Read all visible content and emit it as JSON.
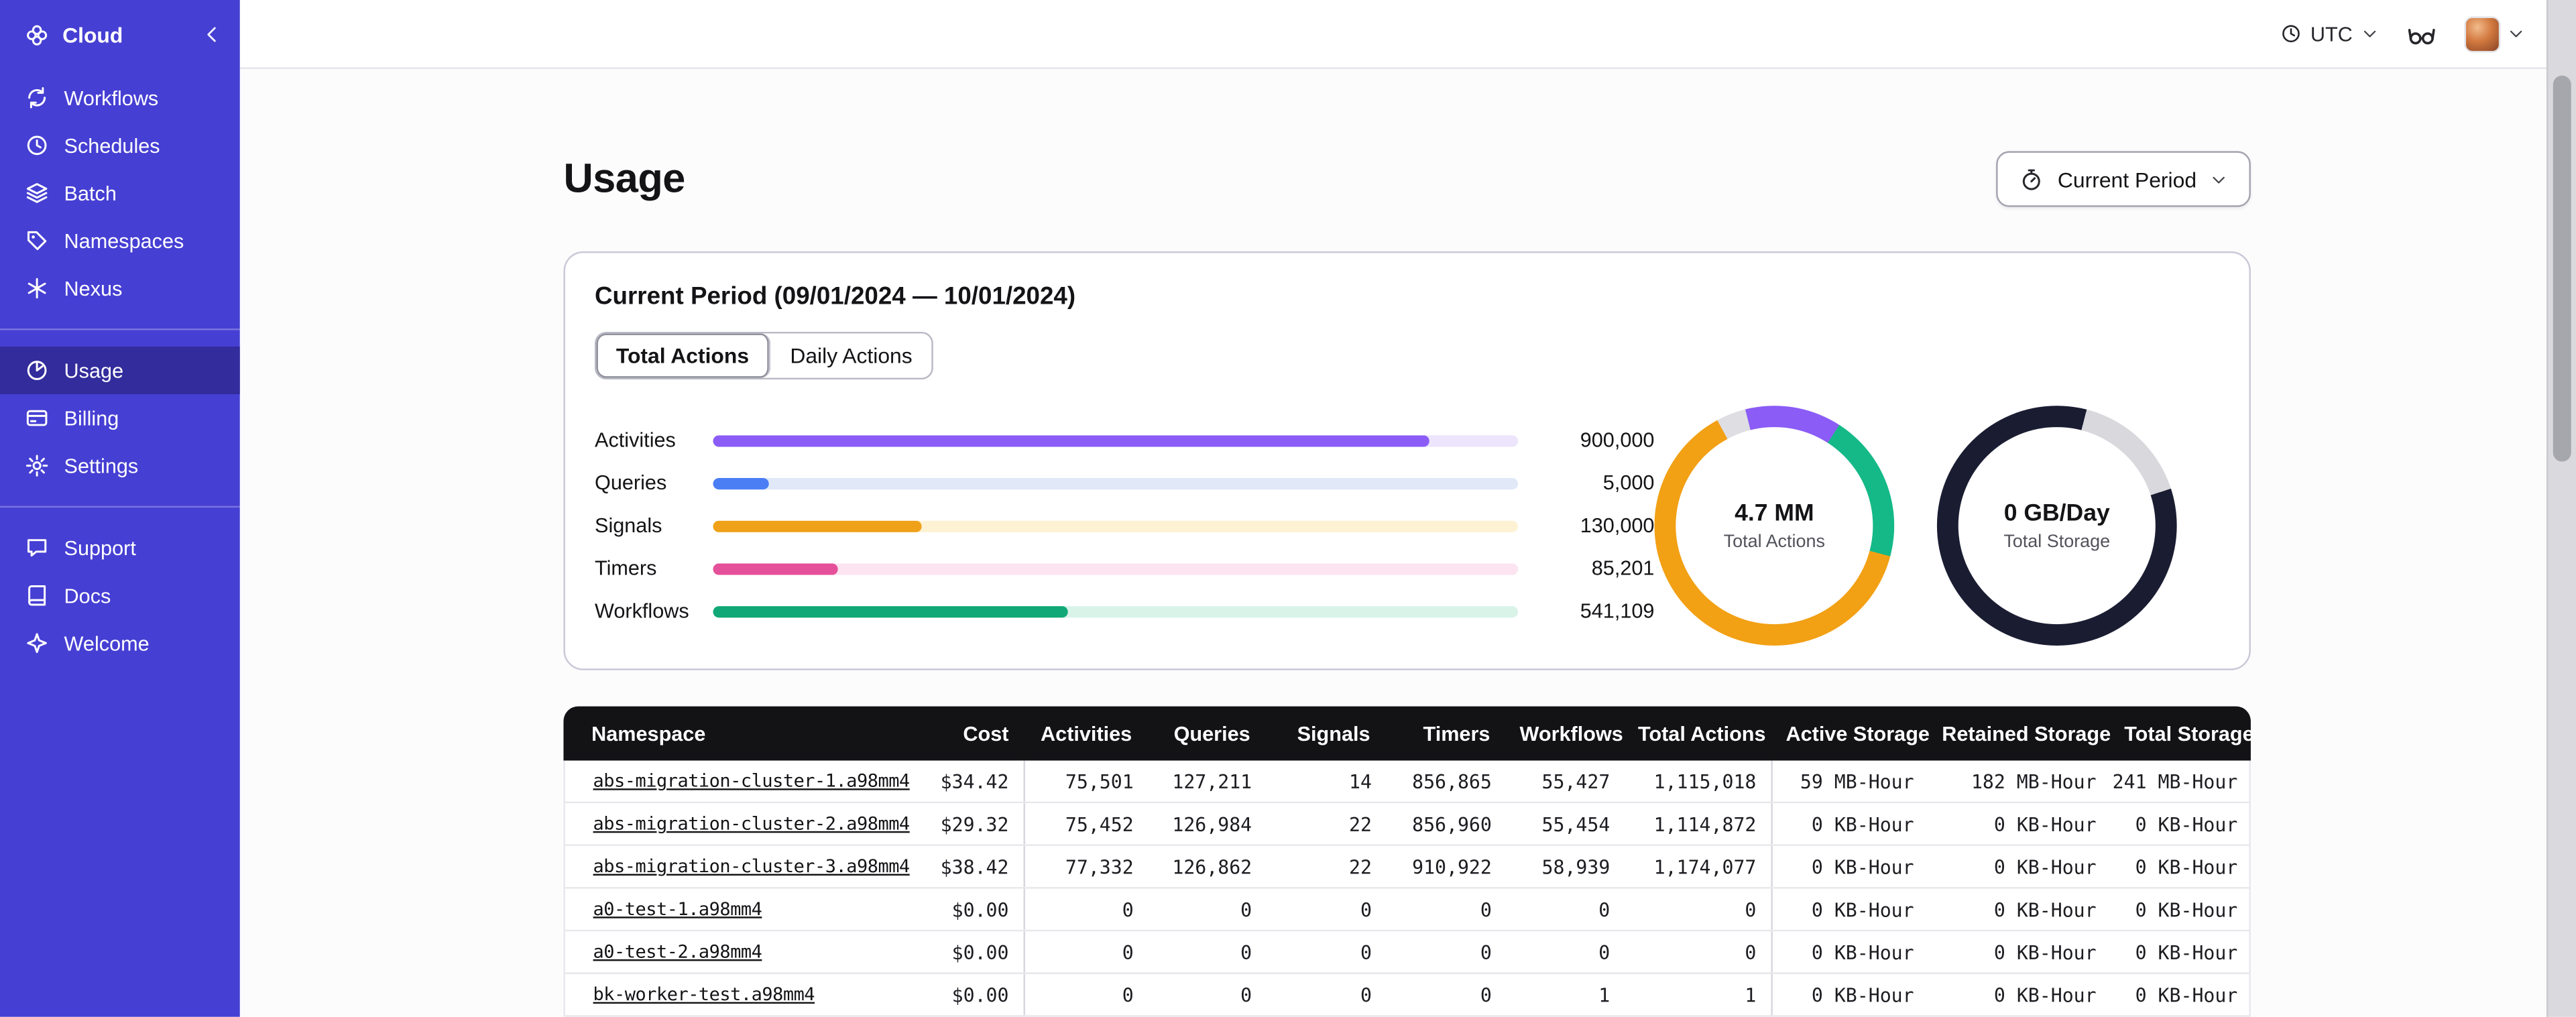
{
  "sidebar": {
    "logo_label": "Cloud",
    "items_main": [
      {
        "label": "Workflows",
        "icon": "workflows-icon"
      },
      {
        "label": "Schedules",
        "icon": "schedules-icon"
      },
      {
        "label": "Batch",
        "icon": "batch-icon"
      },
      {
        "label": "Namespaces",
        "icon": "namespaces-icon"
      },
      {
        "label": "Nexus",
        "icon": "nexus-icon"
      }
    ],
    "items_account": [
      {
        "label": "Usage",
        "icon": "usage-icon",
        "active": true
      },
      {
        "label": "Billing",
        "icon": "billing-icon"
      },
      {
        "label": "Settings",
        "icon": "settings-icon"
      }
    ],
    "items_footer": [
      {
        "label": "Support",
        "icon": "support-icon"
      },
      {
        "label": "Docs",
        "icon": "docs-icon"
      },
      {
        "label": "Welcome",
        "icon": "welcome-icon"
      }
    ]
  },
  "topbar": {
    "timezone": "UTC"
  },
  "page": {
    "title": "Usage",
    "period_button_label": "Current Period"
  },
  "card": {
    "title": "Current Period (09/01/2024 — 10/01/2024)",
    "tabs": [
      {
        "label": "Total Actions",
        "active": true
      },
      {
        "label": "Daily Actions",
        "active": false
      }
    ]
  },
  "chart_data": [
    {
      "type": "bar",
      "orientation": "horizontal",
      "categories": [
        "Activities",
        "Queries",
        "Signals",
        "Timers",
        "Workflows"
      ],
      "values": [
        900000,
        5000,
        130000,
        85201,
        541109
      ],
      "value_labels": [
        "900,000",
        "5,000",
        "130,000",
        "85,201",
        "541,109"
      ],
      "bar_colors": [
        "#8b5cf6",
        "#4b7ef5",
        "#f0a11a",
        "#e5509a",
        "#10a877"
      ],
      "track_colors": [
        "#ece5fc",
        "#e1e8f8",
        "#fdf2d3",
        "#fce4f0",
        "#d9f3e9"
      ],
      "fill_pct": [
        89,
        7,
        26,
        15.5,
        44
      ]
    },
    {
      "type": "pie",
      "title": "Total Actions",
      "center_value": "4.7 MM",
      "start_deg": -14,
      "segments": [
        {
          "name": "activities",
          "color": "#8b5cf6",
          "pct": 13
        },
        {
          "name": "workflows",
          "color": "#14b987",
          "pct": 20
        },
        {
          "name": "signals",
          "color": "#f2a014",
          "pct": 63
        },
        {
          "name": "other",
          "color": "#dedee3",
          "pct": 4
        }
      ]
    },
    {
      "type": "pie",
      "title": "Total Storage",
      "center_value": "0 GB/Day",
      "start_deg": 0,
      "segments": [
        {
          "name": "storage",
          "color": "#1a1d32",
          "pct": 4
        },
        {
          "name": "retained-segment",
          "color": "#d8d8dd",
          "pct": 16
        },
        {
          "name": "storage-rest",
          "color": "#1a1d32",
          "pct": 80
        }
      ]
    }
  ],
  "table": {
    "columns": [
      "Namespace",
      "Cost",
      "Activities",
      "Queries",
      "Signals",
      "Timers",
      "Workflows",
      "Total Actions",
      "Active Storage",
      "Retained Storage",
      "Total Storage"
    ],
    "rows": [
      [
        "abs-migration-cluster-1.a98mm4",
        "$34.42",
        "75,501",
        "127,211",
        "14",
        "856,865",
        "55,427",
        "1,115,018",
        "59 MB-Hour",
        "182 MB-Hour",
        "241 MB-Hour"
      ],
      [
        "abs-migration-cluster-2.a98mm4",
        "$29.32",
        "75,452",
        "126,984",
        "22",
        "856,960",
        "55,454",
        "1,114,872",
        "0 KB-Hour",
        "0 KB-Hour",
        "0 KB-Hour"
      ],
      [
        "abs-migration-cluster-3.a98mm4",
        "$38.42",
        "77,332",
        "126,862",
        "22",
        "910,922",
        "58,939",
        "1,174,077",
        "0 KB-Hour",
        "0 KB-Hour",
        "0 KB-Hour"
      ],
      [
        "a0-test-1.a98mm4",
        "$0.00",
        "0",
        "0",
        "0",
        "0",
        "0",
        "0",
        "0 KB-Hour",
        "0 KB-Hour",
        "0 KB-Hour"
      ],
      [
        "a0-test-2.a98mm4",
        "$0.00",
        "0",
        "0",
        "0",
        "0",
        "0",
        "0",
        "0 KB-Hour",
        "0 KB-Hour",
        "0 KB-Hour"
      ],
      [
        "bk-worker-test.a98mm4",
        "$0.00",
        "0",
        "0",
        "0",
        "0",
        "1",
        "1",
        "0 KB-Hour",
        "0 KB-Hour",
        "0 KB-Hour"
      ]
    ]
  },
  "colors": {
    "sidebar": "#463fd3",
    "sidebar_active": "#332c9c",
    "table_header": "#131316"
  }
}
